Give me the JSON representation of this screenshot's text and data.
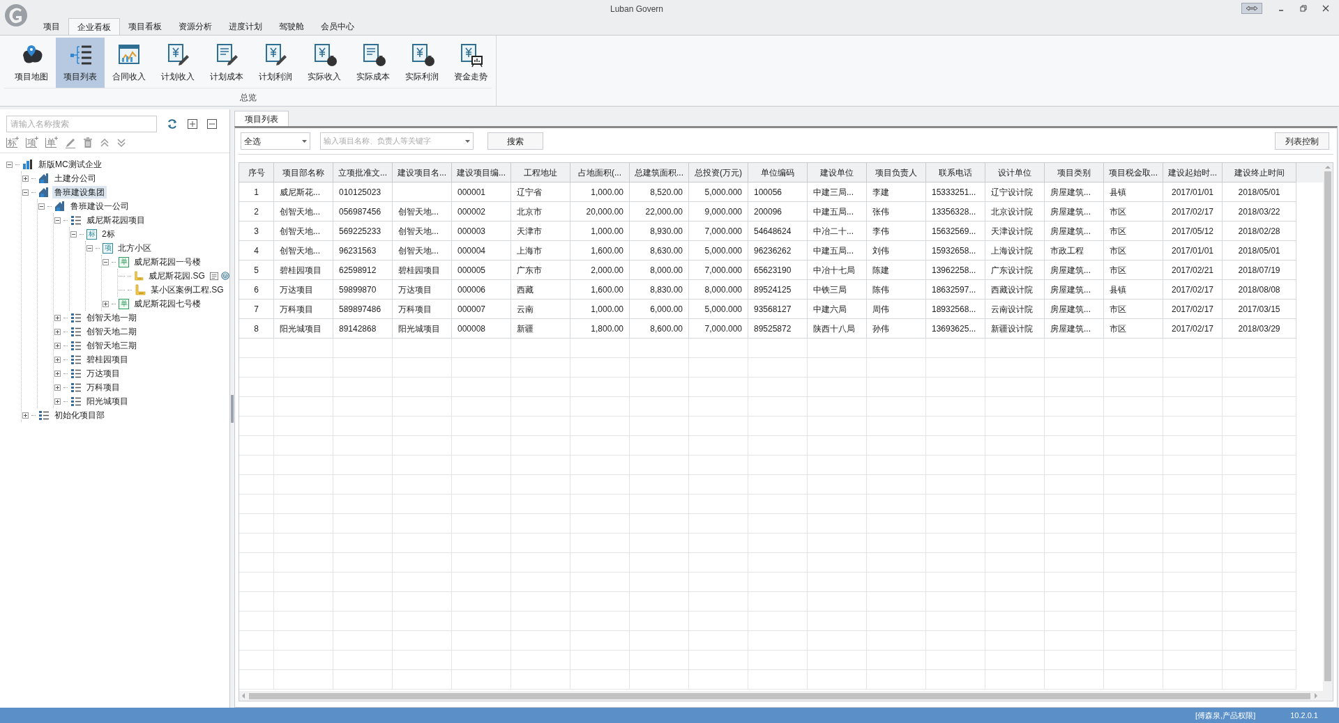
{
  "window": {
    "title": "Luban Govern"
  },
  "menu_tabs": [
    {
      "label": "项目",
      "selected": false
    },
    {
      "label": "企业看板",
      "selected": true
    },
    {
      "label": "项目看板",
      "selected": false
    },
    {
      "label": "资源分析",
      "selected": false
    },
    {
      "label": "进度计划",
      "selected": false
    },
    {
      "label": "驾驶舱",
      "selected": false
    },
    {
      "label": "会员中心",
      "selected": false
    }
  ],
  "ribbon": {
    "group_label": "总览",
    "buttons": [
      {
        "label": "项目地图",
        "kind": "map",
        "selected": false
      },
      {
        "label": "项目列表",
        "kind": "list",
        "selected": true
      },
      {
        "label": "合同收入",
        "kind": "chart",
        "selected": false
      },
      {
        "label": "计划收入",
        "kind": "yenpen",
        "selected": false
      },
      {
        "label": "计划成本",
        "kind": "linespen",
        "selected": false
      },
      {
        "label": "计划利润",
        "kind": "yenpen",
        "selected": false
      },
      {
        "label": "实际收入",
        "kind": "yenbag",
        "selected": false
      },
      {
        "label": "实际成本",
        "kind": "linesbag",
        "selected": false
      },
      {
        "label": "实际利润",
        "kind": "yenbag",
        "selected": false
      },
      {
        "label": "资金走势",
        "kind": "yenboard",
        "selected": false
      }
    ]
  },
  "left_panel": {
    "search": {
      "placeholder": "请输入名称搜索"
    },
    "toolbar": [
      {
        "kind": "add",
        "glyph": "标"
      },
      {
        "kind": "add",
        "glyph": "项"
      },
      {
        "kind": "add",
        "glyph": "单"
      },
      {
        "kind": "edit"
      },
      {
        "kind": "delete"
      },
      {
        "kind": "up"
      },
      {
        "kind": "down"
      }
    ],
    "tree": [
      {
        "label": "新版MC测试企业",
        "kind": "enterprise",
        "selected": false,
        "expanded": true,
        "children": [
          {
            "label": "土建分公司",
            "kind": "company",
            "selected": false,
            "expanded": false
          },
          {
            "label": "鲁班建设集团",
            "kind": "company",
            "selected": true,
            "expanded": true,
            "children": [
              {
                "label": "鲁班建设一公司",
                "kind": "company",
                "selected": false,
                "expanded": true,
                "children": [
                  {
                    "label": "威尼斯花园项目",
                    "kind": "project",
                    "selected": false,
                    "expanded": true,
                    "children": [
                      {
                        "label": "2标",
                        "kind": "tag",
                        "glyph": "标",
                        "selected": false,
                        "expanded": true,
                        "children": [
                          {
                            "label": "北方小区",
                            "kind": "tag",
                            "glyph": "项",
                            "selected": false,
                            "expanded": true,
                            "children": [
                              {
                                "label": "威尼斯花园一号楼",
                                "kind": "unit",
                                "glyph": "单",
                                "selected": false,
                                "expanded": true,
                                "children": [
                                  {
                                    "label": "威尼斯花园.SG",
                                    "kind": "file",
                                    "selected": false,
                                    "actions": true
                                  },
                                  {
                                    "label": "某小区案例工程.SG",
                                    "kind": "file",
                                    "selected": false,
                                    "actions": false
                                  }
                                ]
                              },
                              {
                                "label": "威尼斯花园七号楼",
                                "kind": "unit",
                                "glyph": "单",
                                "selected": false,
                                "expanded": false
                              }
                            ]
                          }
                        ]
                      }
                    ]
                  },
                  {
                    "label": "创智天地一期",
                    "kind": "project",
                    "selected": false,
                    "expanded": false
                  },
                  {
                    "label": "创智天地二期",
                    "kind": "project",
                    "selected": false,
                    "expanded": false
                  },
                  {
                    "label": "创智天地三期",
                    "kind": "project",
                    "selected": false,
                    "expanded": false
                  },
                  {
                    "label": "碧桂园项目",
                    "kind": "project",
                    "selected": false,
                    "expanded": false
                  },
                  {
                    "label": "万达项目",
                    "kind": "project",
                    "selected": false,
                    "expanded": false
                  },
                  {
                    "label": "万科项目",
                    "kind": "project",
                    "selected": false,
                    "expanded": false
                  },
                  {
                    "label": "阳光城项目",
                    "kind": "project",
                    "selected": false,
                    "expanded": false
                  }
                ]
              }
            ]
          },
          {
            "label": "初始化项目部",
            "kind": "project",
            "selected": false,
            "expanded": false
          }
        ]
      }
    ]
  },
  "doc_tab": {
    "label": "项目列表",
    "selected": true
  },
  "filter": {
    "scope": "全选",
    "keyword": {
      "placeholder": "输入项目名称、负责人等关键字"
    },
    "search_button": "搜索",
    "columns_button": "列表控制"
  },
  "table": {
    "columns": [
      {
        "label": "序号",
        "kind": "index"
      },
      {
        "label": "项目部名称",
        "kind": "text"
      },
      {
        "label": "立项批准文...",
        "kind": "text"
      },
      {
        "label": "建设项目名...",
        "kind": "text"
      },
      {
        "label": "建设项目编...",
        "kind": "text"
      },
      {
        "label": "工程地址",
        "kind": "text"
      },
      {
        "label": "占地面积(...",
        "kind": "number"
      },
      {
        "label": "总建筑面积...",
        "kind": "number"
      },
      {
        "label": "总投资(万元)",
        "kind": "number"
      },
      {
        "label": "单位编码",
        "kind": "text"
      },
      {
        "label": "建设单位",
        "kind": "text"
      },
      {
        "label": "项目负责人",
        "kind": "text"
      },
      {
        "label": "联系电话",
        "kind": "text"
      },
      {
        "label": "设计单位",
        "kind": "text"
      },
      {
        "label": "项目类别",
        "kind": "text"
      },
      {
        "label": "项目税金取...",
        "kind": "text"
      },
      {
        "label": "建设起始时...",
        "kind": "date"
      },
      {
        "label": "建设终止时间",
        "kind": "date"
      }
    ],
    "rows": [
      [
        "1",
        "威尼斯花...",
        "010125023",
        null,
        "000001",
        "辽宁省",
        "1,000.00",
        "8,520.00",
        "5,000.000",
        "100056",
        "中建三局...",
        "李建",
        "15333251...",
        "辽宁设计院",
        "房屋建筑...",
        "县镇",
        "2017/01/01",
        "2018/05/01"
      ],
      [
        "2",
        "创智天地...",
        "056987456",
        "创智天地...",
        "000002",
        "北京市",
        "20,000.00",
        "22,000.00",
        "9,000.000",
        "200096",
        "中建五局...",
        "张伟",
        "13356328...",
        "北京设计院",
        "房屋建筑...",
        "市区",
        "2017/02/17",
        "2018/03/22"
      ],
      [
        "3",
        "创智天地...",
        "569225233",
        "创智天地...",
        "000003",
        "天津市",
        "1,000.00",
        "8,930.00",
        "7,000.000",
        "54648624",
        "中冶二十...",
        "李伟",
        "15632569...",
        "天津设计院",
        "房屋建筑...",
        "市区",
        "2017/05/12",
        "2018/02/28"
      ],
      [
        "4",
        "创智天地...",
        "96231563",
        "创智天地...",
        "000004",
        "上海市",
        "1,600.00",
        "8,630.00",
        "5,000.000",
        "96236262",
        "中建五局...",
        "刘伟",
        "15932658...",
        "上海设计院",
        "市政工程",
        "市区",
        "2017/01/01",
        "2018/05/01"
      ],
      [
        "5",
        "碧桂园项目",
        "62598912",
        "碧桂园项目",
        "000005",
        "广东市",
        "2,000.00",
        "8,000.00",
        "7,000.000",
        "65623190",
        "中冶十七局",
        "陈建",
        "13962258...",
        "广东设计院",
        "房屋建筑...",
        "市区",
        "2017/02/21",
        "2018/07/19"
      ],
      [
        "6",
        "万达项目",
        "59899870",
        "万达项目",
        "000006",
        "西藏",
        "1,600.00",
        "8,830.00",
        "8,000.000",
        "89524125",
        "中铁三局",
        "陈伟",
        "18632597...",
        "西藏设计院",
        "房屋建筑...",
        "县镇",
        "2017/02/17",
        "2018/08/08"
      ],
      [
        "7",
        "万科项目",
        "589897486",
        "万科项目",
        "000007",
        "云南",
        "1,000.00",
        "6,000.00",
        "5,000.000",
        "93568127",
        "中建六局",
        "周伟",
        "18932568...",
        "云南设计院",
        "房屋建筑...",
        "市区",
        "2017/02/17",
        "2017/03/15"
      ],
      [
        "8",
        "阳光城项目",
        "89142868",
        "阳光城项目",
        "000008",
        "新疆",
        "1,800.00",
        "8,600.00",
        "7,000.000",
        "89525872",
        "陕西十八局",
        "孙伟",
        "13693625...",
        "新疆设计院",
        "房屋建筑...",
        "市区",
        "2017/02/17",
        "2018/03/29"
      ]
    ]
  },
  "status_bar": {
    "user": "[傅森泉,产品权限]",
    "version": "10.2.0.1"
  }
}
